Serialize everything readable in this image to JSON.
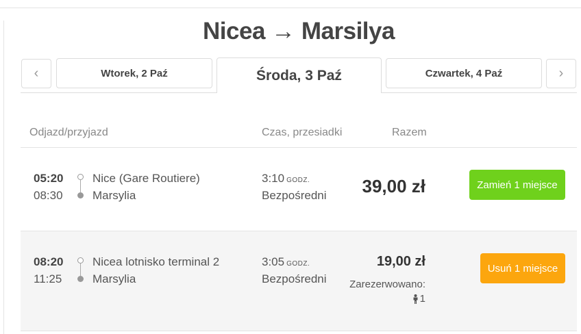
{
  "route_title": "Nicea → Marsilya",
  "date_nav": {
    "prev_label": "‹",
    "next_label": "›",
    "tabs": [
      {
        "label": "Wtorek, 2 Paź",
        "active": false
      },
      {
        "label": "Środa, 3 Paź",
        "active": true
      },
      {
        "label": "Czwartek, 4 Paź",
        "active": false
      }
    ]
  },
  "columns": {
    "departure_arrival": "Odjazd/przyjazd",
    "time_transfers": "Czas, przesiadki",
    "total": "Razem"
  },
  "trips": [
    {
      "departure_time": "05:20",
      "arrival_time": "08:30",
      "from": "Nice (Gare Routiere)",
      "to": "Marsylia",
      "duration": "3:10",
      "duration_unit": "GODZ.",
      "transfers": "Bezpośredni",
      "price": "39,00 zł",
      "reserved_label": "",
      "reserved_count": "",
      "action_label": "Zamień 1 miejsce",
      "action_color": "#6fd11c"
    },
    {
      "departure_time": "08:20",
      "arrival_time": "11:25",
      "from": "Nicea lotnisko terminal 2",
      "to": "Marsylia",
      "duration": "3:05",
      "duration_unit": "GODZ.",
      "transfers": "Bezpośredni",
      "price": "19,00 zł",
      "reserved_label": "Zarezerwowano:",
      "reserved_count": "1",
      "action_label": "Usuń 1 miejsce",
      "action_color": "#fca60e"
    }
  ],
  "icons": {
    "prev": "chevron-left-icon",
    "next": "chevron-right-icon",
    "route_start": "open-circle-icon",
    "route_end": "filled-circle-icon",
    "person": "person-icon"
  }
}
